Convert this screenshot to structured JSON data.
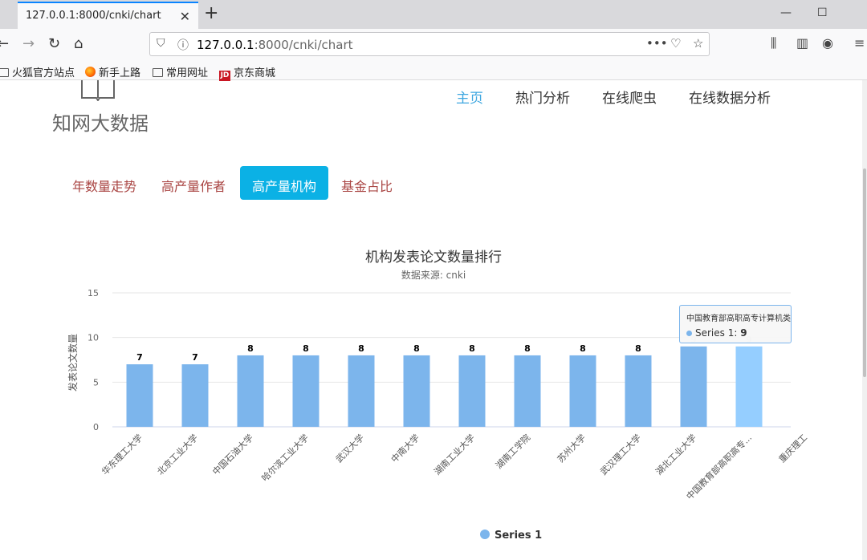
{
  "browser": {
    "tab_title": "127.0.0.1:8000/cnki/chart",
    "url_host": "127.0.0.1",
    "url_rest": ":8000/cnki/chart",
    "bookmarks": [
      "火狐官方站点",
      "新手上路",
      "常用网址",
      "京东商城"
    ]
  },
  "site": {
    "logo": "知网大数据",
    "nav": [
      "主页",
      "热门分析",
      "在线爬虫",
      "在线数据分析"
    ],
    "subnav": [
      "年数量走势",
      "高产量作者",
      "高产量机构",
      "基金占比"
    ]
  },
  "tooltip": {
    "title": "中国教育部高职高专计算机类专业",
    "series": "Series 1",
    "value": "9"
  },
  "chart_data": {
    "type": "bar",
    "title": "机构发表论文数量排行",
    "subtitle": "数据来源: cnki",
    "xlabel": "",
    "ylabel": "发表论文数量",
    "ylim": [
      0,
      15
    ],
    "yticks": [
      0,
      5,
      10,
      15
    ],
    "categories": [
      "华东理工大学",
      "北京工业大学",
      "中国石油大学",
      "哈尔滨工业大学",
      "武汉大学",
      "中南大学",
      "湖南工业大学",
      "湖南工学院",
      "苏州大学",
      "武汉理工大学",
      "湖北工业大学",
      "中国教育部高职高专...",
      "重庆理工"
    ],
    "series": [
      {
        "name": "Series 1",
        "values": [
          7,
          7,
          8,
          8,
          8,
          8,
          8,
          8,
          8,
          8,
          9,
          9,
          null
        ]
      }
    ],
    "highlight_index": 11,
    "grid": true,
    "legend": "bottom-center",
    "colors": {
      "bar": "#7cb5ec",
      "bar_highlight": "#95ceff"
    }
  }
}
